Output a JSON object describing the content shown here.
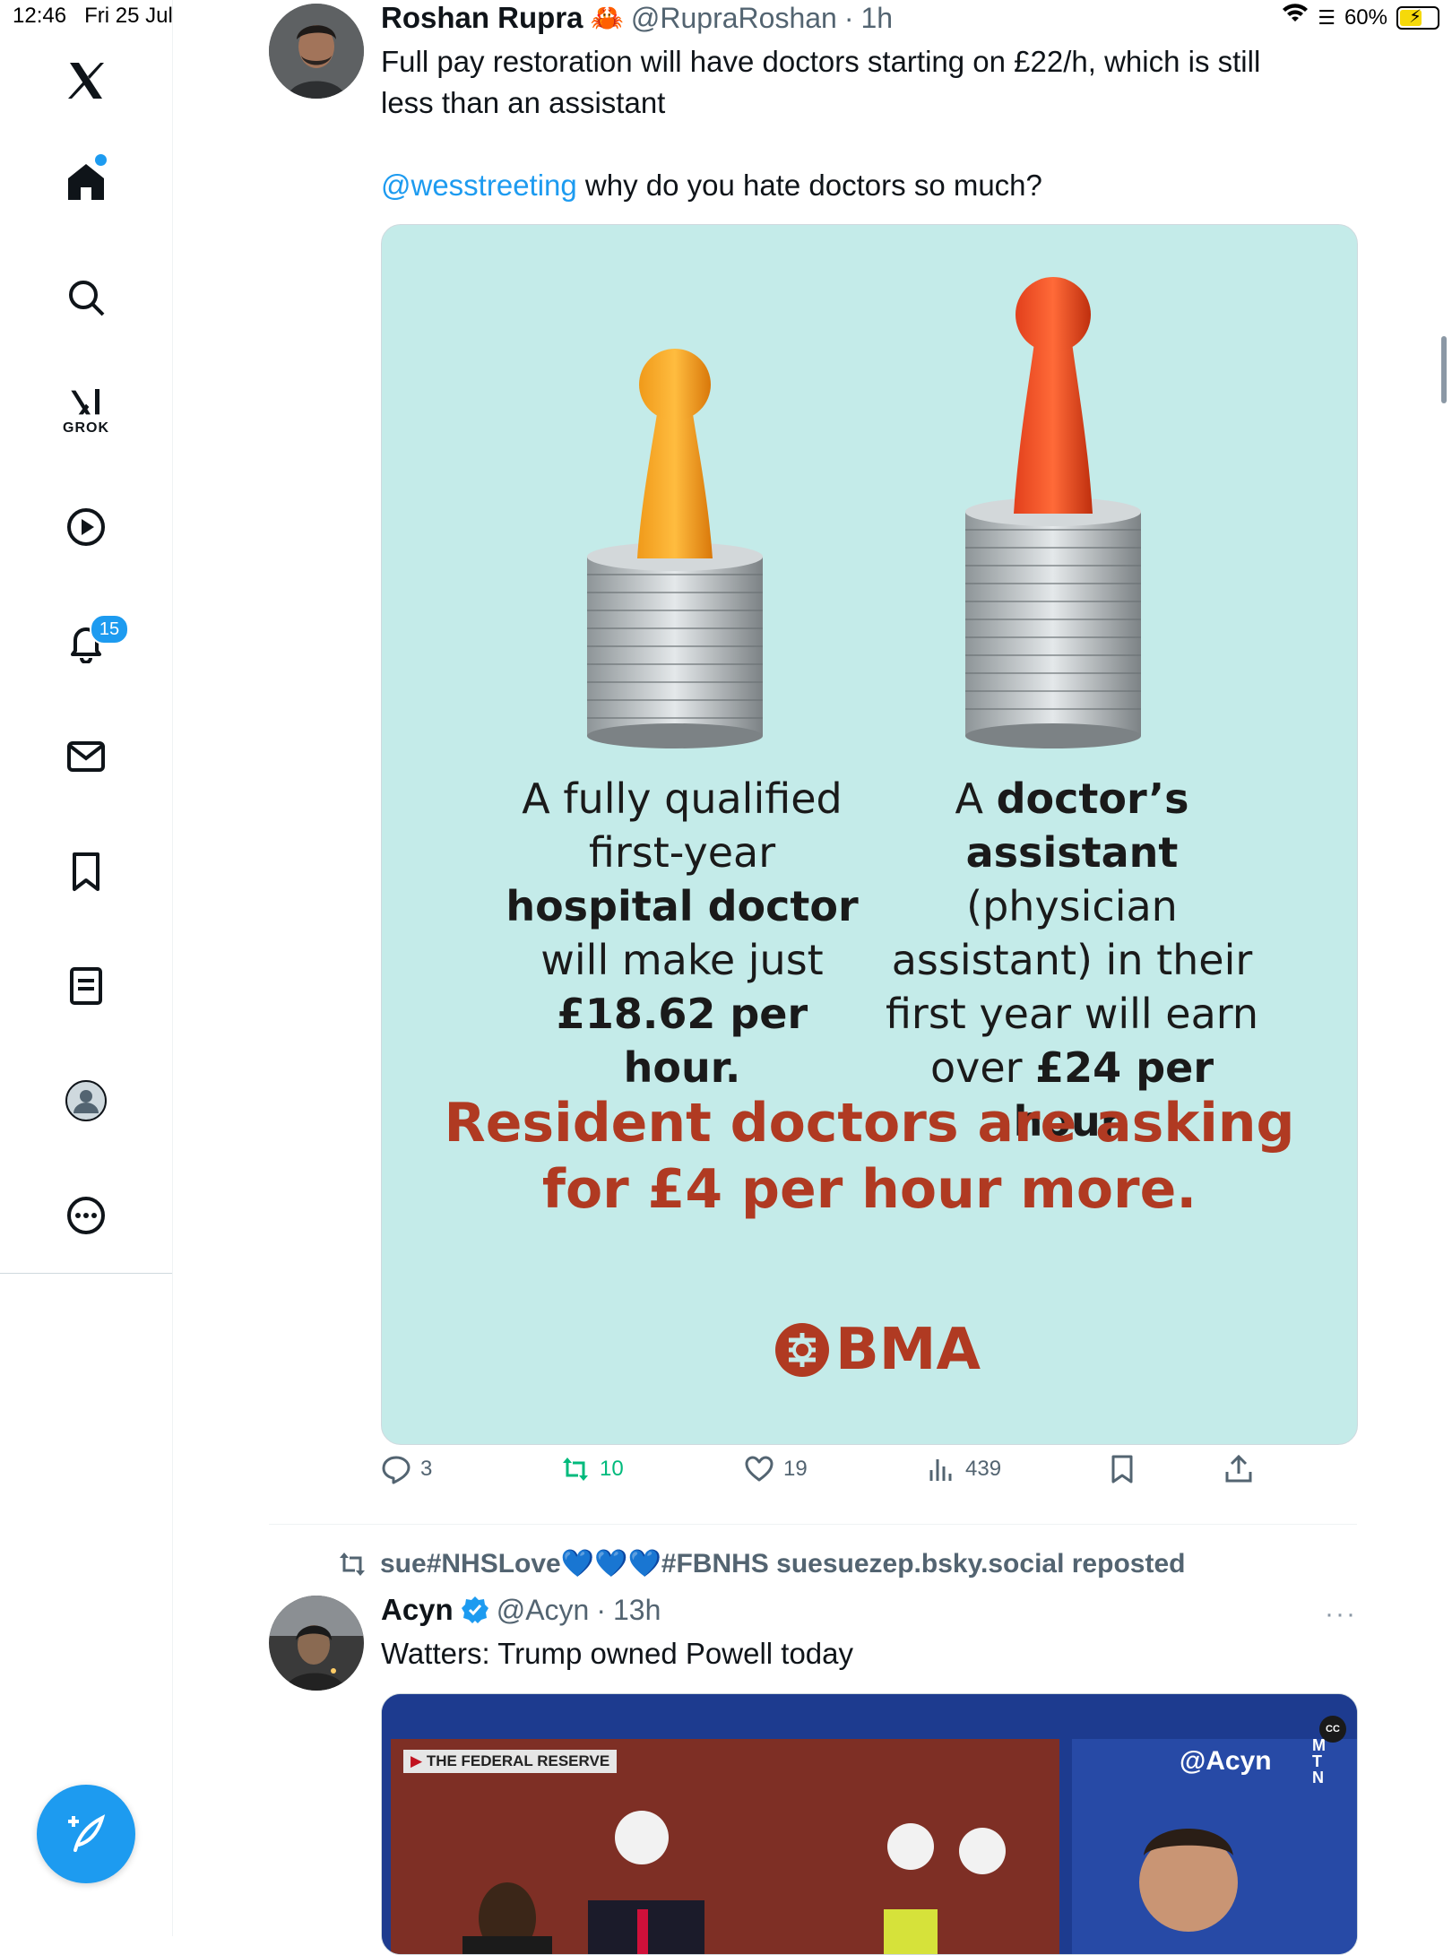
{
  "status_bar": {
    "time": "12:46",
    "date": "Fri 25 Jul",
    "battery": "60%",
    "battery_level": 0.6
  },
  "sidebar": {
    "logo": "x-logo-icon",
    "notifications_count": "15",
    "grok_label": "GROK",
    "items": [
      "home-icon",
      "search-icon",
      "grok-icon",
      "video-icon",
      "notifications-icon",
      "messages-icon",
      "bookmarks-icon",
      "lists-icon",
      "profile-icon",
      "more-icon"
    ]
  },
  "tweet1": {
    "name": "Roshan Rupra",
    "emoji": "🦀",
    "handle": "@RupraRoshan",
    "time": "1h",
    "text_line1": "Full pay restoration will have doctors starting on £22/h, which is still",
    "text_line2": "less than an assistant",
    "mention": "@wesstreeting",
    "text_tail": " why do you hate doctors so much?",
    "media": {
      "left_col": [
        "A fully qualified",
        "first-year",
        "hospital doctor",
        "will make just",
        "£18.62 per hour."
      ],
      "right_col_1a": "A ",
      "right_col_1b": "doctor’s",
      "right_col_2a": "assistant",
      "right_col_2b": " (physician",
      "right_col_3": "assistant) in their",
      "right_col_4": "first year will earn",
      "right_col_5a": "over ",
      "right_col_5b": "£24 per hour.",
      "headline_1": "Resident doctors are asking",
      "headline_2": "for £4 per hour more.",
      "logo_text": "BMA"
    },
    "stats": {
      "replies": "3",
      "reposts": "10",
      "likes": "19",
      "views": "439"
    }
  },
  "tweet2": {
    "repost_by": "sue#NHSLove💙💙💙#FBNHS suesuezep.bsky.social reposted",
    "name": "Acyn",
    "handle": "@Acyn",
    "time": "13h",
    "text": "Watters: Trump owned Powell today",
    "video_banner": "THE FEDERAL RESERVE",
    "video_watermark": "@Acyn",
    "video_channel": "MTN",
    "cc_label": "CC"
  },
  "colors": {
    "accent": "#1d9bf0",
    "repost_green": "#00ba7c",
    "bma_red": "#b03a22",
    "media_bg": "#c4ebe9"
  }
}
